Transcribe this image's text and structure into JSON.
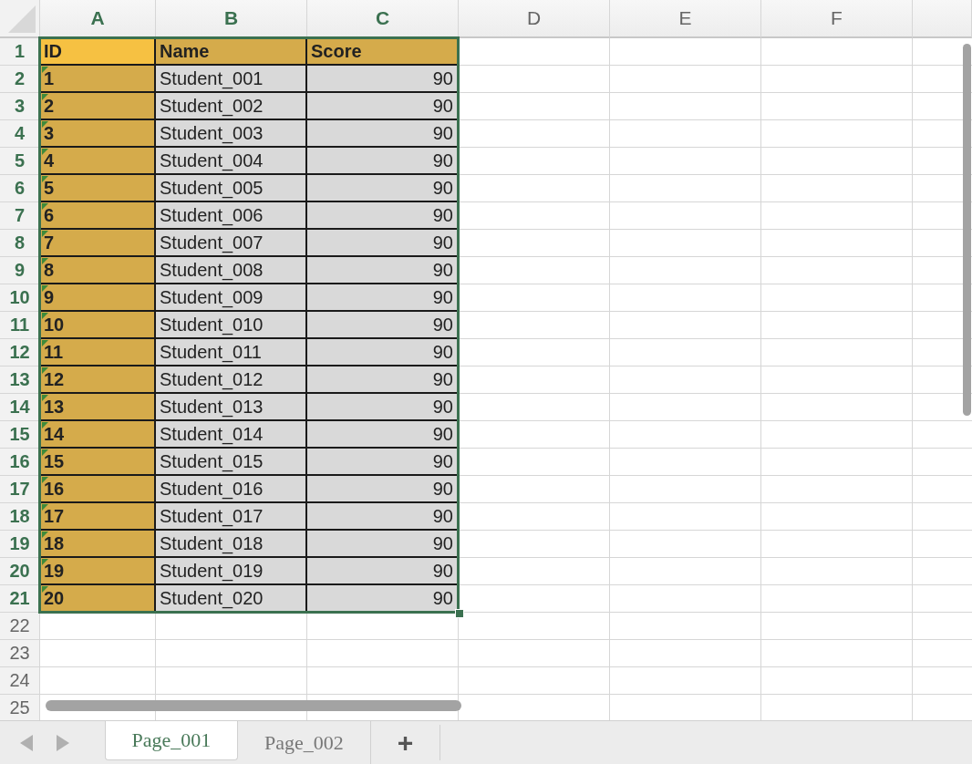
{
  "column_headers": [
    {
      "label": "A",
      "selected": true
    },
    {
      "label": "B",
      "selected": true
    },
    {
      "label": "C",
      "selected": true
    },
    {
      "label": "D",
      "selected": false
    },
    {
      "label": "E",
      "selected": false
    },
    {
      "label": "F",
      "selected": false
    }
  ],
  "row_headers": [
    {
      "label": "1",
      "selected": true
    },
    {
      "label": "2",
      "selected": true
    },
    {
      "label": "3",
      "selected": true
    },
    {
      "label": "4",
      "selected": true
    },
    {
      "label": "5",
      "selected": true
    },
    {
      "label": "6",
      "selected": true
    },
    {
      "label": "7",
      "selected": true
    },
    {
      "label": "8",
      "selected": true
    },
    {
      "label": "9",
      "selected": true
    },
    {
      "label": "10",
      "selected": true
    },
    {
      "label": "11",
      "selected": true
    },
    {
      "label": "12",
      "selected": true
    },
    {
      "label": "13",
      "selected": true
    },
    {
      "label": "14",
      "selected": true
    },
    {
      "label": "15",
      "selected": true
    },
    {
      "label": "16",
      "selected": true
    },
    {
      "label": "17",
      "selected": true
    },
    {
      "label": "18",
      "selected": true
    },
    {
      "label": "19",
      "selected": true
    },
    {
      "label": "20",
      "selected": true
    },
    {
      "label": "21",
      "selected": true
    },
    {
      "label": "22",
      "selected": false
    },
    {
      "label": "23",
      "selected": false
    },
    {
      "label": "24",
      "selected": false
    },
    {
      "label": "25",
      "selected": false
    }
  ],
  "rows": [
    {
      "cells": [
        {
          "text": "ID",
          "kind": "header",
          "active": true,
          "flagged": false
        },
        {
          "text": "Name",
          "kind": "header",
          "active": false,
          "flagged": false
        },
        {
          "text": "Score",
          "kind": "header",
          "active": false,
          "flagged": false
        }
      ]
    },
    {
      "cells": [
        {
          "text": "1",
          "kind": "id",
          "active": false,
          "flagged": true
        },
        {
          "text": "Student_001",
          "kind": "name",
          "active": false,
          "flagged": false
        },
        {
          "text": "90",
          "kind": "score",
          "active": false,
          "flagged": false
        }
      ]
    },
    {
      "cells": [
        {
          "text": "2",
          "kind": "id",
          "active": false,
          "flagged": true
        },
        {
          "text": "Student_002",
          "kind": "name",
          "active": false,
          "flagged": false
        },
        {
          "text": "90",
          "kind": "score",
          "active": false,
          "flagged": false
        }
      ]
    },
    {
      "cells": [
        {
          "text": "3",
          "kind": "id",
          "active": false,
          "flagged": true
        },
        {
          "text": "Student_003",
          "kind": "name",
          "active": false,
          "flagged": false
        },
        {
          "text": "90",
          "kind": "score",
          "active": false,
          "flagged": false
        }
      ]
    },
    {
      "cells": [
        {
          "text": "4",
          "kind": "id",
          "active": false,
          "flagged": true
        },
        {
          "text": "Student_004",
          "kind": "name",
          "active": false,
          "flagged": false
        },
        {
          "text": "90",
          "kind": "score",
          "active": false,
          "flagged": false
        }
      ]
    },
    {
      "cells": [
        {
          "text": "5",
          "kind": "id",
          "active": false,
          "flagged": true
        },
        {
          "text": "Student_005",
          "kind": "name",
          "active": false,
          "flagged": false
        },
        {
          "text": "90",
          "kind": "score",
          "active": false,
          "flagged": false
        }
      ]
    },
    {
      "cells": [
        {
          "text": "6",
          "kind": "id",
          "active": false,
          "flagged": true
        },
        {
          "text": "Student_006",
          "kind": "name",
          "active": false,
          "flagged": false
        },
        {
          "text": "90",
          "kind": "score",
          "active": false,
          "flagged": false
        }
      ]
    },
    {
      "cells": [
        {
          "text": "7",
          "kind": "id",
          "active": false,
          "flagged": true
        },
        {
          "text": "Student_007",
          "kind": "name",
          "active": false,
          "flagged": false
        },
        {
          "text": "90",
          "kind": "score",
          "active": false,
          "flagged": false
        }
      ]
    },
    {
      "cells": [
        {
          "text": "8",
          "kind": "id",
          "active": false,
          "flagged": true
        },
        {
          "text": "Student_008",
          "kind": "name",
          "active": false,
          "flagged": false
        },
        {
          "text": "90",
          "kind": "score",
          "active": false,
          "flagged": false
        }
      ]
    },
    {
      "cells": [
        {
          "text": "9",
          "kind": "id",
          "active": false,
          "flagged": true
        },
        {
          "text": "Student_009",
          "kind": "name",
          "active": false,
          "flagged": false
        },
        {
          "text": "90",
          "kind": "score",
          "active": false,
          "flagged": false
        }
      ]
    },
    {
      "cells": [
        {
          "text": "10",
          "kind": "id",
          "active": false,
          "flagged": true
        },
        {
          "text": "Student_010",
          "kind": "name",
          "active": false,
          "flagged": false
        },
        {
          "text": "90",
          "kind": "score",
          "active": false,
          "flagged": false
        }
      ]
    },
    {
      "cells": [
        {
          "text": "11",
          "kind": "id",
          "active": false,
          "flagged": true
        },
        {
          "text": "Student_011",
          "kind": "name",
          "active": false,
          "flagged": false
        },
        {
          "text": "90",
          "kind": "score",
          "active": false,
          "flagged": false
        }
      ]
    },
    {
      "cells": [
        {
          "text": "12",
          "kind": "id",
          "active": false,
          "flagged": true
        },
        {
          "text": "Student_012",
          "kind": "name",
          "active": false,
          "flagged": false
        },
        {
          "text": "90",
          "kind": "score",
          "active": false,
          "flagged": false
        }
      ]
    },
    {
      "cells": [
        {
          "text": "13",
          "kind": "id",
          "active": false,
          "flagged": true
        },
        {
          "text": "Student_013",
          "kind": "name",
          "active": false,
          "flagged": false
        },
        {
          "text": "90",
          "kind": "score",
          "active": false,
          "flagged": false
        }
      ]
    },
    {
      "cells": [
        {
          "text": "14",
          "kind": "id",
          "active": false,
          "flagged": true
        },
        {
          "text": "Student_014",
          "kind": "name",
          "active": false,
          "flagged": false
        },
        {
          "text": "90",
          "kind": "score",
          "active": false,
          "flagged": false
        }
      ]
    },
    {
      "cells": [
        {
          "text": "15",
          "kind": "id",
          "active": false,
          "flagged": true
        },
        {
          "text": "Student_015",
          "kind": "name",
          "active": false,
          "flagged": false
        },
        {
          "text": "90",
          "kind": "score",
          "active": false,
          "flagged": false
        }
      ]
    },
    {
      "cells": [
        {
          "text": "16",
          "kind": "id",
          "active": false,
          "flagged": true
        },
        {
          "text": "Student_016",
          "kind": "name",
          "active": false,
          "flagged": false
        },
        {
          "text": "90",
          "kind": "score",
          "active": false,
          "flagged": false
        }
      ]
    },
    {
      "cells": [
        {
          "text": "17",
          "kind": "id",
          "active": false,
          "flagged": true
        },
        {
          "text": "Student_017",
          "kind": "name",
          "active": false,
          "flagged": false
        },
        {
          "text": "90",
          "kind": "score",
          "active": false,
          "flagged": false
        }
      ]
    },
    {
      "cells": [
        {
          "text": "18",
          "kind": "id",
          "active": false,
          "flagged": true
        },
        {
          "text": "Student_018",
          "kind": "name",
          "active": false,
          "flagged": false
        },
        {
          "text": "90",
          "kind": "score",
          "active": false,
          "flagged": false
        }
      ]
    },
    {
      "cells": [
        {
          "text": "19",
          "kind": "id",
          "active": false,
          "flagged": true
        },
        {
          "text": "Student_019",
          "kind": "name",
          "active": false,
          "flagged": false
        },
        {
          "text": "90",
          "kind": "score",
          "active": false,
          "flagged": false
        }
      ]
    },
    {
      "cells": [
        {
          "text": "20",
          "kind": "id",
          "active": false,
          "flagged": true
        },
        {
          "text": "Student_020",
          "kind": "name",
          "active": false,
          "flagged": false
        },
        {
          "text": "90",
          "kind": "score",
          "active": false,
          "flagged": false
        }
      ]
    }
  ],
  "sheet_tabs": [
    {
      "label": "Page_001",
      "selected": true
    },
    {
      "label": "Page_002",
      "selected": false
    }
  ],
  "add_sheet_button": "+"
}
